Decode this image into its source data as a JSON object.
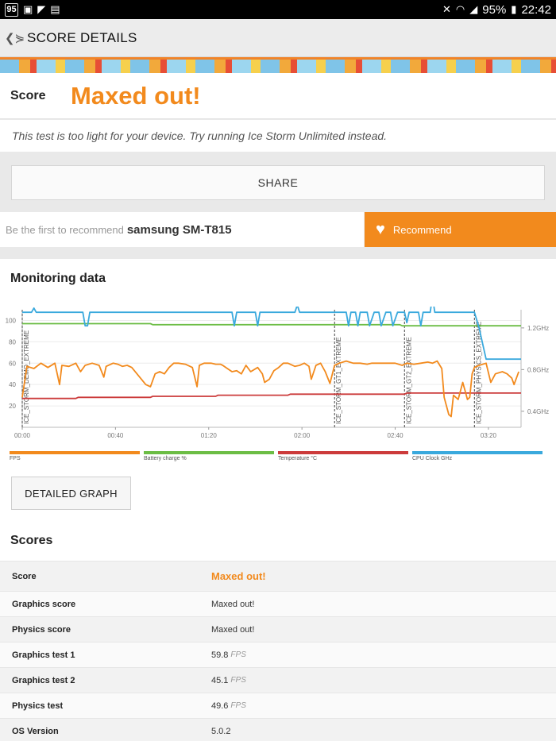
{
  "status_bar": {
    "badge": "95",
    "battery": "95%",
    "time": "22:42"
  },
  "app_bar": {
    "title": "SCORE DETAILS"
  },
  "score": {
    "label": "Score",
    "value": "Maxed out!"
  },
  "note": "This test is too light for your device. Try running Ice Storm Unlimited instead.",
  "share_label": "SHARE",
  "recommend": {
    "prefix": "Be the first to recommend",
    "device": "samsung SM-T815",
    "button": "Recommend"
  },
  "monitoring": {
    "title": "Monitoring data",
    "detail_button": "DETAILED GRAPH"
  },
  "chart_data": {
    "type": "line",
    "x_ticks": [
      "00:00",
      "00:40",
      "01:20",
      "02:00",
      "02:40",
      "03:20"
    ],
    "y_ticks": [
      "100",
      "80",
      "60",
      "40",
      "20"
    ],
    "y2_ticks": [
      "1.2GHz",
      "0.8GHz",
      "0.4GHz"
    ],
    "ylim": [
      0,
      110
    ],
    "xlim_seconds": [
      0,
      214
    ],
    "sections": [
      {
        "label": "ICE_STORM_DEMO_EXTREME",
        "t": 0
      },
      {
        "label": "ICE_STORM_GT1_EXTREME",
        "t": 134
      },
      {
        "label": "ICE_STORM_GT2_EXTREME",
        "t": 164
      },
      {
        "label": "ICE_STORM_PHYSICS_EXTREME",
        "t": 194
      }
    ],
    "series": [
      {
        "name": "FPS",
        "color": "#f28a1d",
        "axis": "left",
        "points": [
          [
            0,
            28
          ],
          [
            2,
            57
          ],
          [
            5,
            55
          ],
          [
            8,
            60
          ],
          [
            11,
            56
          ],
          [
            14,
            60
          ],
          [
            16,
            40
          ],
          [
            17,
            58
          ],
          [
            20,
            57
          ],
          [
            23,
            60
          ],
          [
            25,
            52
          ],
          [
            27,
            58
          ],
          [
            30,
            60
          ],
          [
            33,
            58
          ],
          [
            35,
            47
          ],
          [
            36,
            57
          ],
          [
            39,
            60
          ],
          [
            41,
            59
          ],
          [
            43,
            57
          ],
          [
            45,
            58
          ],
          [
            47,
            56
          ],
          [
            50,
            48
          ],
          [
            53,
            40
          ],
          [
            55,
            38
          ],
          [
            57,
            50
          ],
          [
            59,
            52
          ],
          [
            61,
            50
          ],
          [
            63,
            56
          ],
          [
            65,
            60
          ],
          [
            67,
            60
          ],
          [
            70,
            59
          ],
          [
            73,
            56
          ],
          [
            75,
            38
          ],
          [
            76,
            58
          ],
          [
            78,
            60
          ],
          [
            81,
            60
          ],
          [
            83,
            59
          ],
          [
            85,
            59
          ],
          [
            86,
            58
          ],
          [
            88,
            55
          ],
          [
            90,
            52
          ],
          [
            92,
            53
          ],
          [
            94,
            50
          ],
          [
            96,
            58
          ],
          [
            98,
            52
          ],
          [
            101,
            56
          ],
          [
            103,
            50
          ],
          [
            104,
            42
          ],
          [
            106,
            45
          ],
          [
            108,
            53
          ],
          [
            110,
            56
          ],
          [
            112,
            60
          ],
          [
            114,
            60
          ],
          [
            117,
            57
          ],
          [
            119,
            58
          ],
          [
            121,
            60
          ],
          [
            123,
            57
          ],
          [
            124,
            45
          ],
          [
            126,
            58
          ],
          [
            128,
            60
          ],
          [
            130,
            52
          ],
          [
            132,
            41
          ],
          [
            134,
            58
          ],
          [
            136,
            60
          ],
          [
            139,
            62
          ],
          [
            142,
            60
          ],
          [
            145,
            60
          ],
          [
            148,
            59
          ],
          [
            150,
            60
          ],
          [
            153,
            60
          ],
          [
            156,
            60
          ],
          [
            158,
            60
          ],
          [
            160,
            60
          ],
          [
            163,
            58
          ],
          [
            165,
            60
          ],
          [
            168,
            59
          ],
          [
            171,
            60
          ],
          [
            174,
            61
          ],
          [
            176,
            60
          ],
          [
            178,
            62
          ],
          [
            180,
            55
          ],
          [
            181,
            28
          ],
          [
            183,
            12
          ],
          [
            184,
            10
          ],
          [
            185,
            30
          ],
          [
            187,
            26
          ],
          [
            189,
            42
          ],
          [
            190,
            34
          ],
          [
            191,
            26
          ],
          [
            192,
            28
          ],
          [
            193,
            50
          ],
          [
            194,
            56
          ],
          [
            196,
            58
          ],
          [
            199,
            60
          ],
          [
            201,
            42
          ],
          [
            203,
            50
          ],
          [
            206,
            52
          ],
          [
            208,
            50
          ],
          [
            210,
            46
          ],
          [
            211,
            40
          ],
          [
            213,
            52
          ]
        ]
      },
      {
        "name": "Battery charge %",
        "color": "#6cbd45",
        "axis": "left",
        "points": [
          [
            0,
            97
          ],
          [
            55,
            97
          ],
          [
            56,
            96
          ],
          [
            162,
            96
          ],
          [
            163,
            95
          ],
          [
            214,
            95
          ]
        ]
      },
      {
        "name": "Temperature °C",
        "color": "#cc3b3b",
        "axis": "left",
        "points": [
          [
            0,
            27
          ],
          [
            23,
            27
          ],
          [
            24,
            28
          ],
          [
            55,
            28
          ],
          [
            56,
            29
          ],
          [
            83,
            29
          ],
          [
            84,
            30
          ],
          [
            114,
            30
          ],
          [
            115,
            31
          ],
          [
            164,
            31
          ],
          [
            165,
            32
          ],
          [
            214,
            32
          ]
        ]
      },
      {
        "name": "CPU Clock GHz",
        "color": "#3aa9dd",
        "axis": "right",
        "points": [
          [
            0,
            1.35
          ],
          [
            4,
            1.35
          ],
          [
            5,
            1.39
          ],
          [
            6,
            1.35
          ],
          [
            26,
            1.35
          ],
          [
            27,
            1.22
          ],
          [
            28,
            1.22
          ],
          [
            29,
            1.35
          ],
          [
            90,
            1.35
          ],
          [
            91,
            1.22
          ],
          [
            92,
            1.35
          ],
          [
            100,
            1.35
          ],
          [
            101,
            1.22
          ],
          [
            102,
            1.35
          ],
          [
            117,
            1.35
          ],
          [
            118,
            1.42
          ],
          [
            119,
            1.35
          ],
          [
            139,
            1.35
          ],
          [
            140,
            1.22
          ],
          [
            141,
            1.35
          ],
          [
            143,
            1.35
          ],
          [
            144,
            1.22
          ],
          [
            145,
            1.35
          ],
          [
            148,
            1.35
          ],
          [
            149,
            1.22
          ],
          [
            151,
            1.35
          ],
          [
            153,
            1.35
          ],
          [
            154,
            1.22
          ],
          [
            156,
            1.35
          ],
          [
            158,
            1.35
          ],
          [
            159,
            1.22
          ],
          [
            161,
            1.35
          ],
          [
            164,
            1.35
          ],
          [
            165,
            1.25
          ],
          [
            166,
            1.35
          ],
          [
            170,
            1.35
          ],
          [
            171,
            1.22
          ],
          [
            172,
            1.35
          ],
          [
            175,
            1.35
          ],
          [
            176,
            1.5
          ],
          [
            177,
            1.35
          ],
          [
            194,
            1.35
          ],
          [
            196,
            1.2
          ],
          [
            197,
            1.1
          ],
          [
            199,
            0.9
          ],
          [
            214,
            0.9
          ]
        ]
      }
    ]
  },
  "scores": {
    "title": "Scores",
    "rows": [
      {
        "key": "Score",
        "value": "Maxed out!",
        "unit": ""
      },
      {
        "key": "Graphics score",
        "value": "Maxed out!",
        "unit": ""
      },
      {
        "key": "Physics score",
        "value": "Maxed out!",
        "unit": ""
      },
      {
        "key": "Graphics test 1",
        "value": "59.8",
        "unit": "FPS"
      },
      {
        "key": "Graphics test 2",
        "value": "45.1",
        "unit": "FPS"
      },
      {
        "key": "Physics test",
        "value": "49.6",
        "unit": "FPS"
      },
      {
        "key": "OS Version",
        "value": "5.0.2",
        "unit": ""
      }
    ]
  }
}
